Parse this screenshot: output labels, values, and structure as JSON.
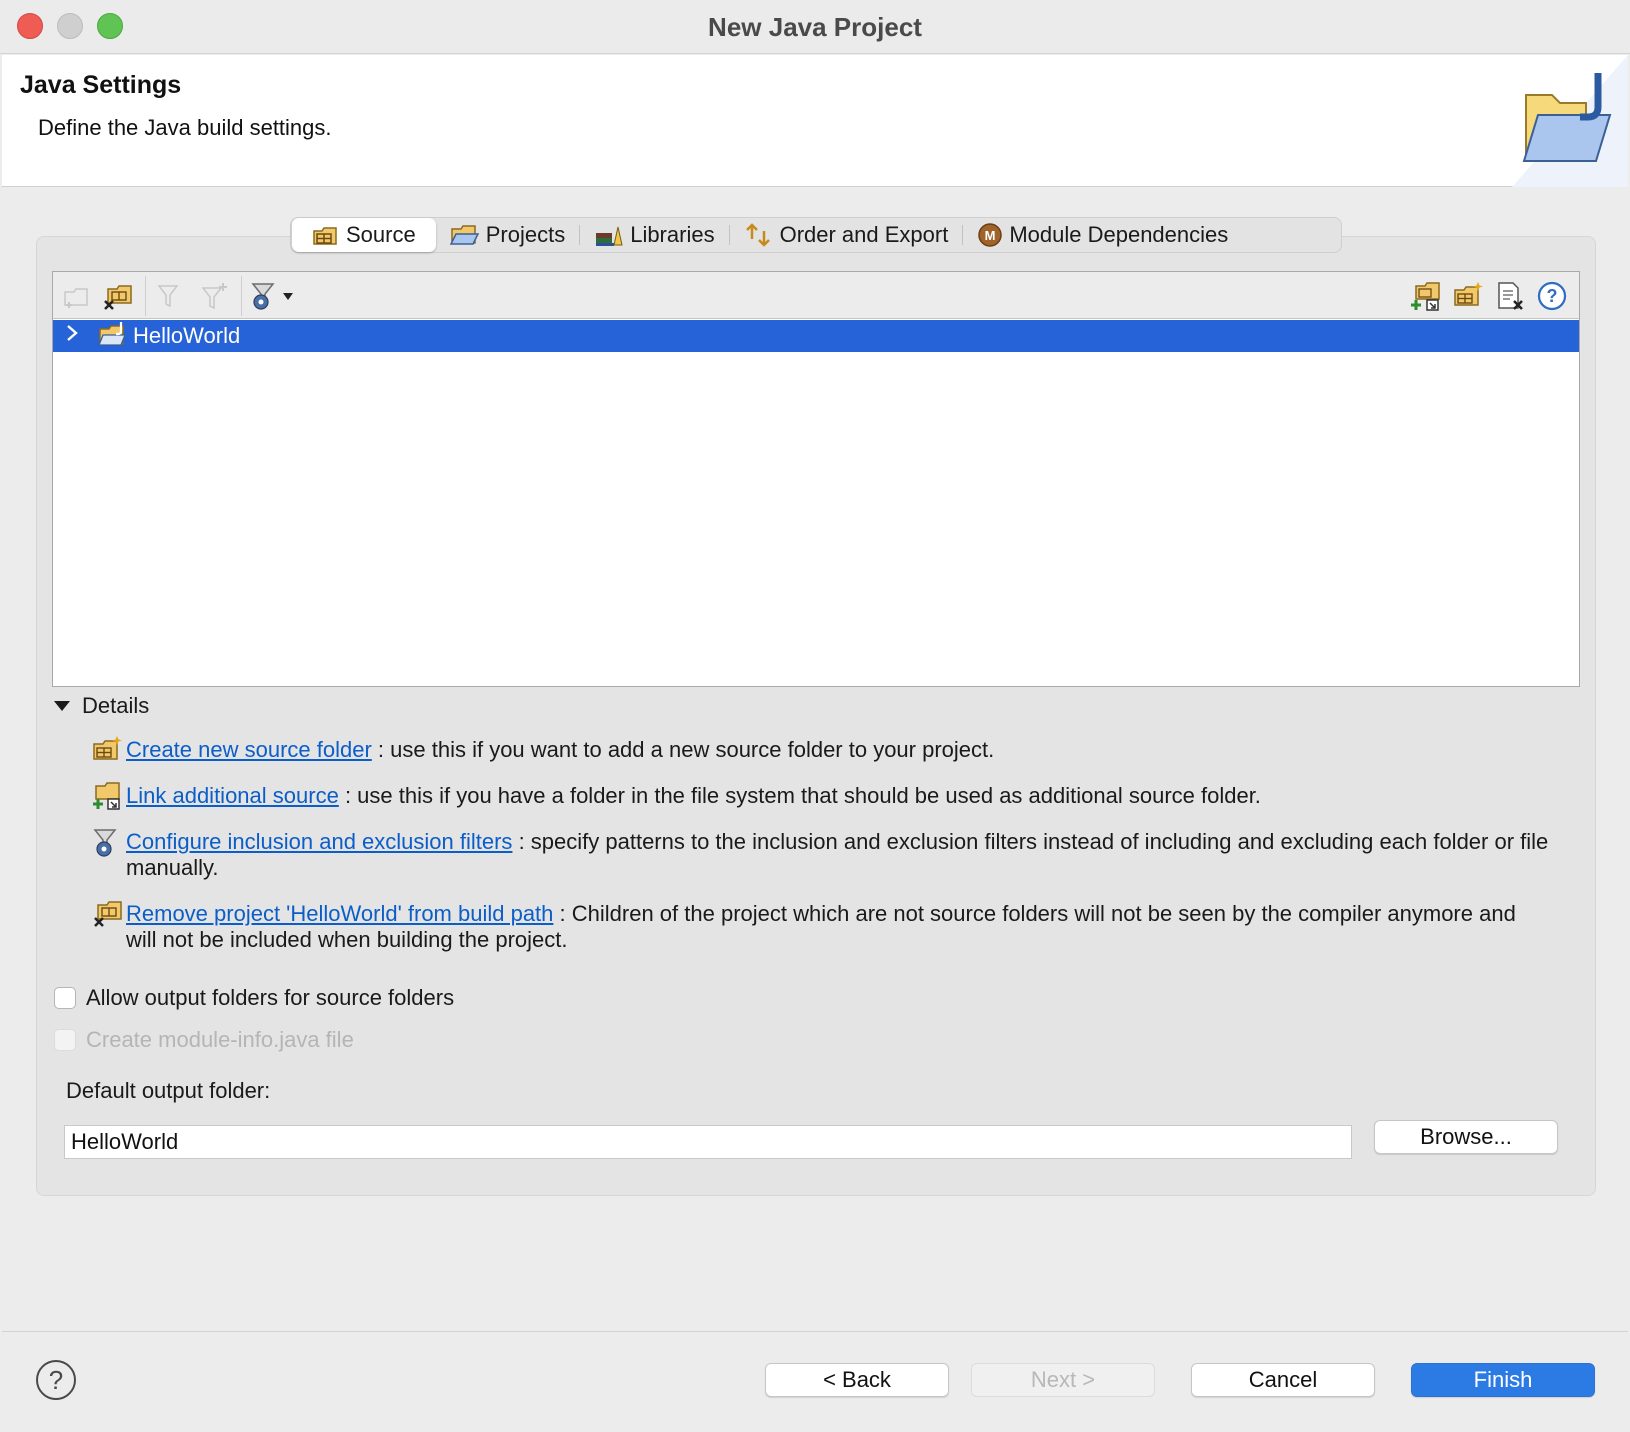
{
  "window": {
    "title": "New Java Project"
  },
  "banner": {
    "title": "Java Settings",
    "description": "Define the Java build settings."
  },
  "tabs": [
    {
      "label": "Source",
      "icon": "source-folder-icon",
      "active": true
    },
    {
      "label": "Projects",
      "icon": "projects-icon"
    },
    {
      "label": "Libraries",
      "icon": "libraries-icon"
    },
    {
      "label": "Order and Export",
      "icon": "order-export-icon"
    },
    {
      "label": "Module Dependencies",
      "icon": "module-icon"
    }
  ],
  "tree": {
    "items": [
      {
        "label": "HelloWorld",
        "expanded": false,
        "selected": true
      }
    ]
  },
  "details": {
    "heading": "Details",
    "items": [
      {
        "link": "Create new source folder",
        "text": ": use this if you want to add a new source folder to your project."
      },
      {
        "link": "Link additional source",
        "text": ": use this if you have a folder in the file system that should be used as additional source folder."
      },
      {
        "link": "Configure inclusion and exclusion filters",
        "text": ": specify patterns to the inclusion and exclusion filters instead of including and excluding each folder or file manually."
      },
      {
        "link": "Remove project 'HelloWorld' from build path",
        "text": ": Children of the project which are not source folders will not be seen by the compiler anymore and will not be included when building the project."
      }
    ]
  },
  "options": {
    "allow_output": "Allow output folders for source folders",
    "create_module_info": "Create module-info.java file"
  },
  "output": {
    "label": "Default output folder:",
    "value": "HelloWorld",
    "browse": "Browse..."
  },
  "buttons": {
    "back": "< Back",
    "next": "Next >",
    "cancel": "Cancel",
    "finish": "Finish"
  },
  "colors": {
    "selection": "#2763d8",
    "link": "#0b5ec9",
    "primary": "#2c7be5"
  }
}
